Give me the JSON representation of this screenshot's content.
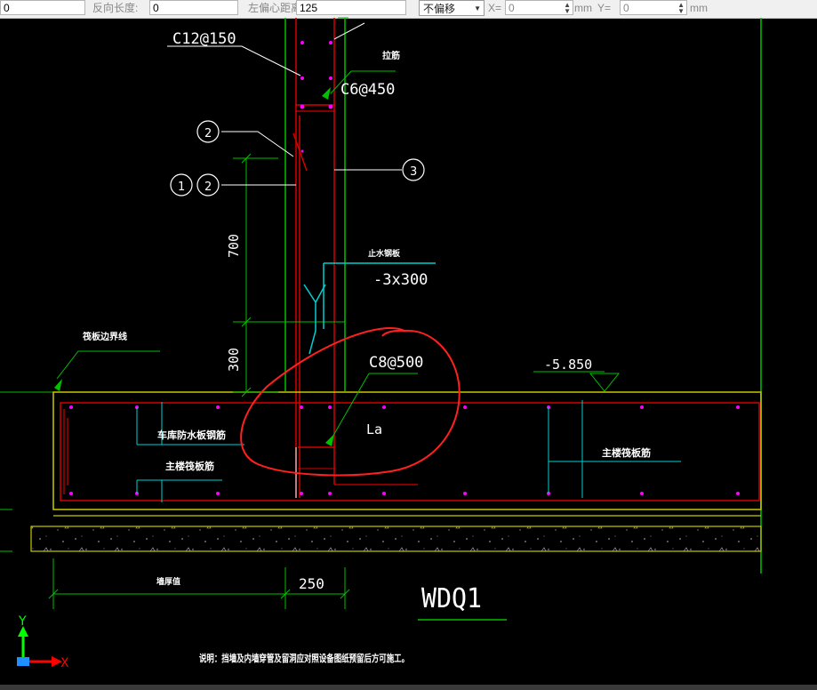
{
  "toolbar": {
    "field0_value": "0",
    "reverse_length_label": "反向长度:",
    "reverse_length_value": "0",
    "left_offset_label": "左偏心距离:",
    "left_offset_value": "125",
    "offset_mode_value": "不偏移",
    "x_label": "X=",
    "x_value": "0",
    "x_unit": "mm",
    "y_label": "Y=",
    "y_value": "0",
    "y_unit": "mm"
  },
  "drawing": {
    "label_c12": "C12@150",
    "label_extrude": "拉筋",
    "label_c6": "C6@450",
    "callout_2a": "2",
    "callout_1": "1",
    "callout_2b": "2",
    "callout_3": "3",
    "dim_700": "700",
    "dim_300": "300",
    "label_waterstop": "止水钢板",
    "label_waterstop_size": "-3x300",
    "label_raft_boundary": "筏板边界线",
    "label_c8": "C8@500",
    "label_la": "La",
    "label_elev": "-5.850",
    "label_garage_rebar": "车库防水板钢筋",
    "label_main_raft_rebar_left": "主楼筏板筋",
    "label_main_raft_rebar_right": "主楼筏板筋",
    "label_wall_thickness": "墙厚值",
    "dim_250": "250",
    "title": "WDQ1",
    "note": "说明：挡墙及内墙穿管及留洞应对照设备图纸预留后方可施工。",
    "axis_y": "Y",
    "axis_x": "X"
  },
  "colors": {
    "background": "#000000",
    "wall_red": "#d40000",
    "outline_yellow": "#c8c800",
    "dim_green": "#00c000",
    "leader_white": "#ffffff",
    "marker_cyan": "#00d0d0",
    "rebar_dot_magenta": "#ff00ff",
    "markup_red": "#ff2020",
    "axis_y_green": "#00ff00",
    "axis_x_red": "#ff0000",
    "axis_arrow_blue": "#1e90ff"
  }
}
